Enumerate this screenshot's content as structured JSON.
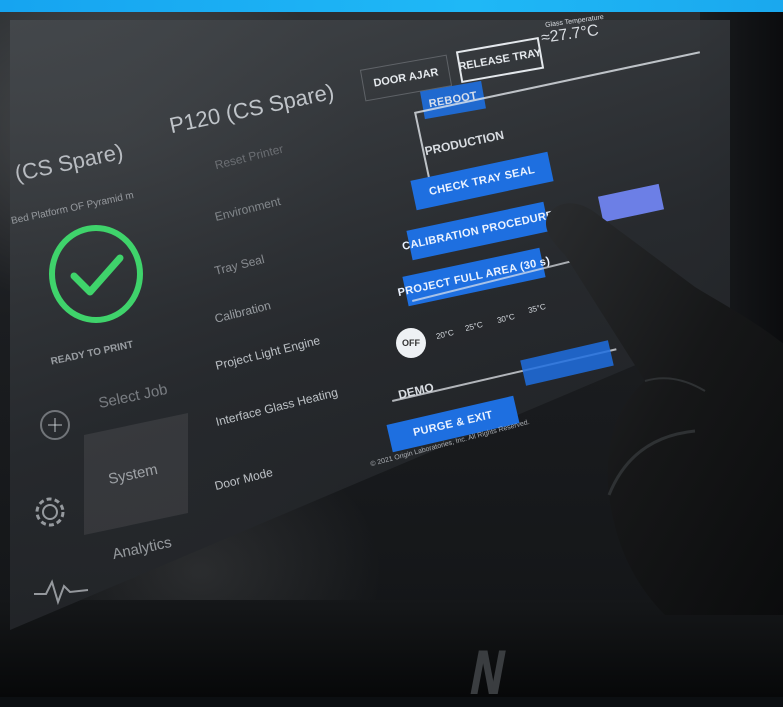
{
  "header": {
    "door_ajar": "DOOR AJAR",
    "release_tray": "RELEASE TRAY",
    "glass_temp_label": "Glass Temperature",
    "glass_temp_value": "≈27.7°C"
  },
  "left_panel": {
    "printer_name_left": "(CS Spare)",
    "printer_name": "P120 (CS Spare)",
    "platform_line": "Bed Platform OF Pyramid m",
    "status": "READY TO PRINT",
    "nav": [
      {
        "label": "Select Job",
        "icon": "plus-circle-icon"
      },
      {
        "label": "System",
        "icon": "gear-icon"
      },
      {
        "label": "Analytics",
        "icon": "pulse-icon"
      }
    ]
  },
  "system_menu": {
    "items": [
      "Reset Printer",
      "Environment",
      "Tray Seal",
      "Calibration",
      "Project Light Engine",
      "Interface Glass Heating",
      "Door Mode"
    ]
  },
  "reboot_button": "REBOOT",
  "production": {
    "title": "PRODUCTION",
    "buttons": [
      "CHECK TRAY SEAL",
      "CALIBRATION PROCEDURE",
      "PROJECT FULL AREA (30 s)"
    ]
  },
  "heater": {
    "off_label": "OFF",
    "ticks": [
      "20°C",
      "25°C",
      "30°C",
      "35°C"
    ]
  },
  "demo": {
    "title": "DEMO",
    "button": "PURGE & EXIT"
  },
  "footer": "© 2021 Origin Laboratories, Inc. All Rights Reserved.",
  "colors": {
    "accent_blue": "#1e6fe0",
    "check_green": "#3fd36b",
    "top_strip": "#1aa8ee"
  }
}
